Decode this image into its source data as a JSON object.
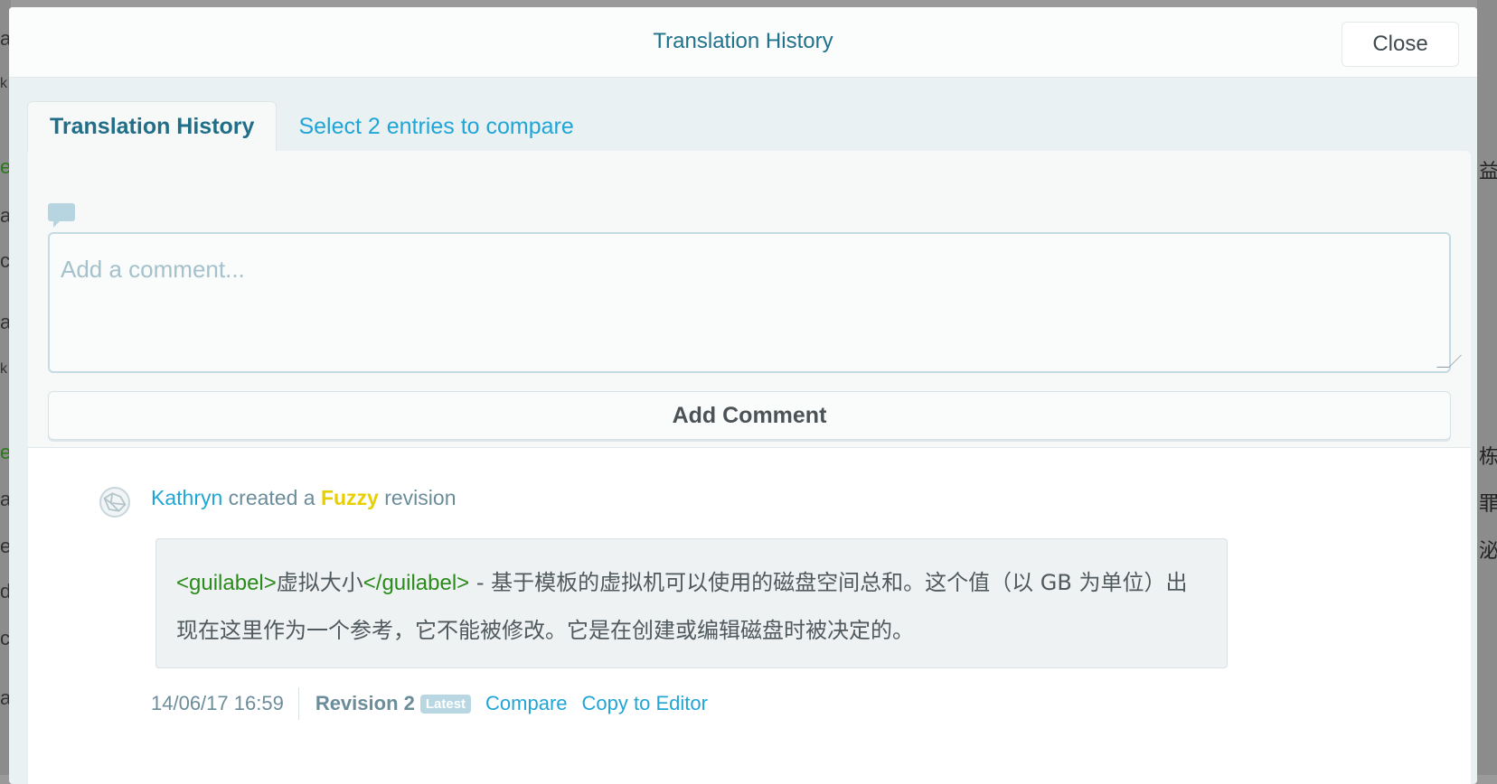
{
  "background": {
    "left_fragments": [
      "ai",
      "k",
      "e",
      "a",
      "c",
      "ai",
      "k",
      "e",
      "ai",
      "e",
      "d",
      "c",
      "ai"
    ],
    "right_fragments": [
      "益",
      "栋",
      "罪",
      "泌"
    ]
  },
  "modal": {
    "title": "Translation History",
    "close_label": "Close"
  },
  "tabs": [
    {
      "label": "Translation History"
    },
    {
      "label": "Select 2 entries to compare"
    }
  ],
  "comment": {
    "placeholder": "Add a comment...",
    "add_label": "Add Comment"
  },
  "entry": {
    "user": "Kathryn",
    "created_text": "created a",
    "state": "Fuzzy",
    "revision_word": "revision",
    "text_tag_open": "<guilabel>",
    "text_tag_content": "虚拟大小",
    "text_tag_close": "</guilabel>",
    "text_body": " - 基于模板的虚拟机可以使用的磁盘空间总和。这个值（以 GB 为单位）出现在这里作为一个参考，它不能被修改。它是在创建或编辑磁盘时被决定的。",
    "timestamp": "14/06/17 16:59",
    "revision_label": "Revision 2",
    "latest_badge": "Latest",
    "compare_label": "Compare",
    "copy_label": "Copy to Editor"
  },
  "colors": {
    "accent": "#1fa5d6",
    "title": "#20718a",
    "fuzzy": "#e8d000",
    "tag": "#2a8a1a"
  }
}
